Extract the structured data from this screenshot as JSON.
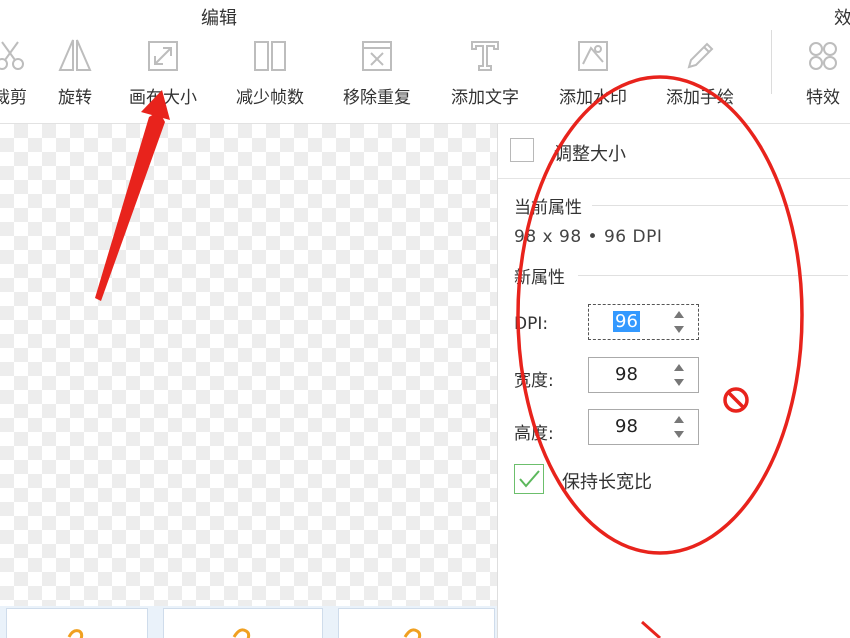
{
  "ribbon": {
    "groups": {
      "edit": "编辑",
      "effects": "效"
    },
    "tools": {
      "crop": "裁剪",
      "rotate": "旋转",
      "canvas_size": "画布大小",
      "reduce_frames": "减少帧数",
      "remove_duplicates": "移除重复",
      "add_text": "添加文字",
      "add_watermark": "添加水印",
      "add_drawing": "添加手绘",
      "effects": "特效"
    }
  },
  "panel": {
    "title": "调整大小",
    "current_section": "当前属性",
    "current_value": "98 x 98 • 96 DPI",
    "new_section": "新属性",
    "dpi_label": "DPI:",
    "dpi_value": "96",
    "width_label": "宽度:",
    "width_value": "98",
    "height_label": "高度:",
    "height_value": "98",
    "keep_ratio_label": "保持长宽比",
    "keep_ratio_checked": true
  },
  "colors": {
    "annotation_red": "#e8231c",
    "check_green": "#5cb85c",
    "selection_blue": "#3399ff"
  }
}
